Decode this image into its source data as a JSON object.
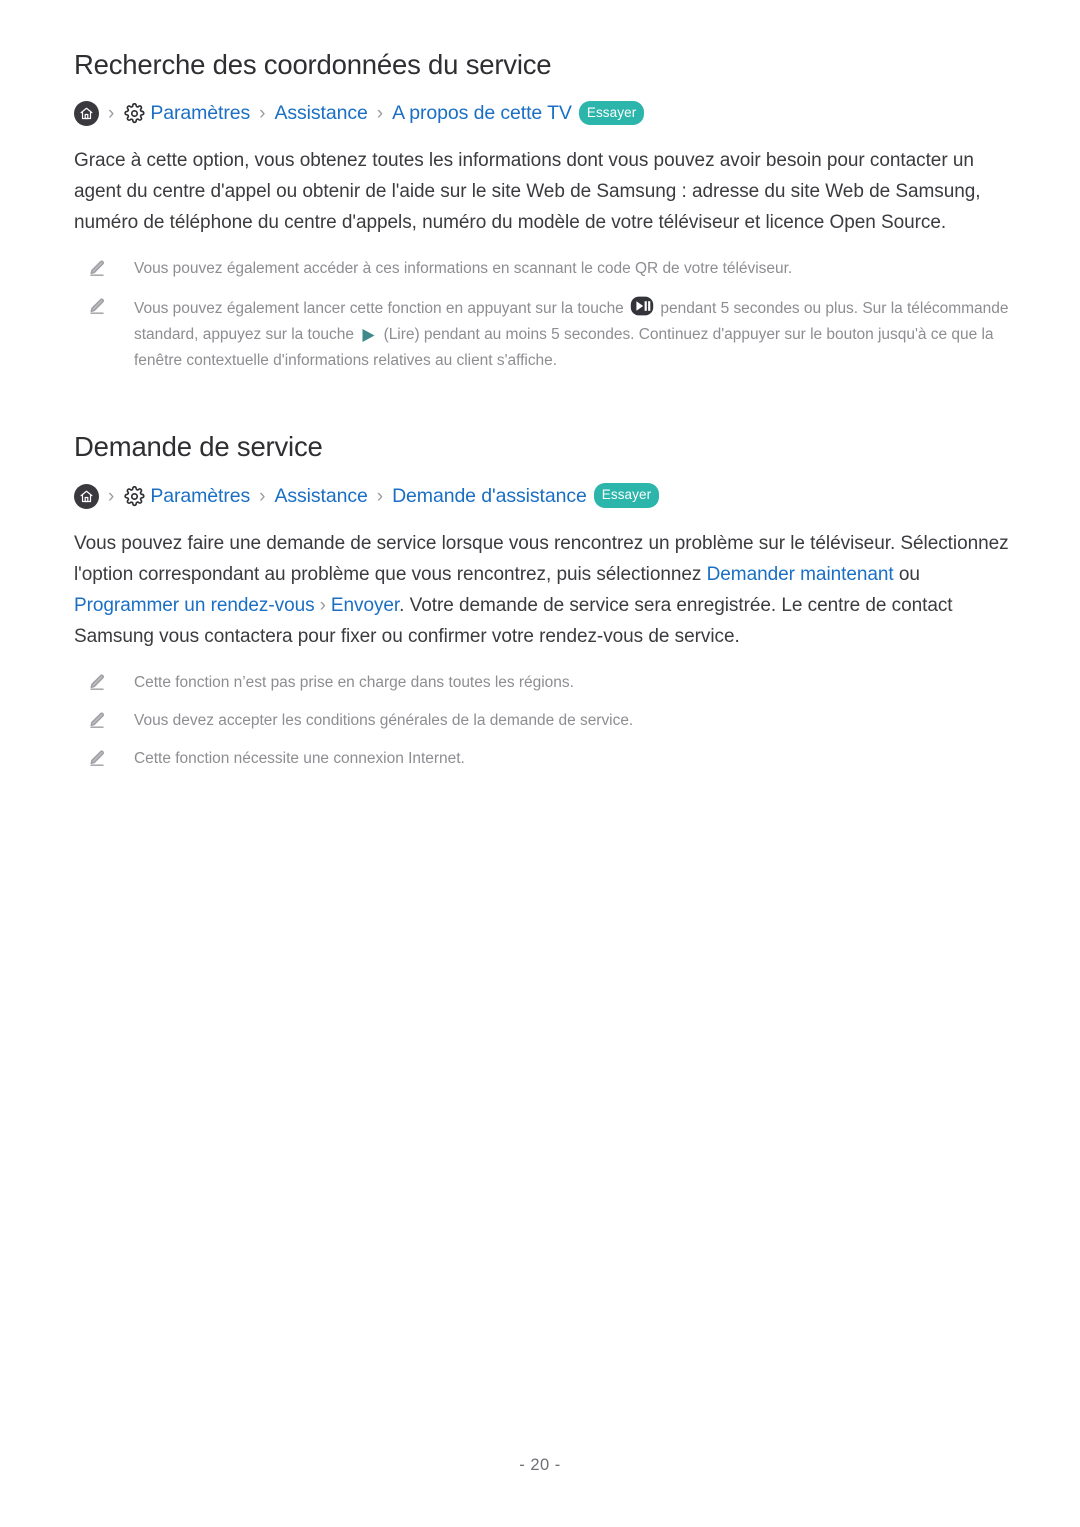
{
  "document": {
    "page_number": "- 20 -"
  },
  "sections": [
    {
      "title": "Recherche des coordonnées du service",
      "breadcrumb": {
        "home_icon": "home-icon",
        "gear_icon": "gear-icon",
        "separator": "›",
        "crumbs": [
          "Paramètres",
          "Assistance",
          "A propos de cette TV"
        ],
        "try_label": "Essayer"
      },
      "paragraph": {
        "text": "Grace à cette option, vous obtenez toutes les informations dont vous pouvez avoir besoin pour contacter un agent du centre d'appel ou obtenir de l'aide sur le site Web de Samsung : adresse du site Web de Samsung, numéro de téléphone du centre d'appels, numéro du modèle de votre téléviseur et licence Open Source."
      },
      "notes": [
        {
          "icon": "pencil-icon",
          "text": "Vous pouvez également accéder à ces informations en scannant le code QR de votre téléviseur."
        },
        {
          "icon": "pencil-icon",
          "part1": "Vous pouvez également lancer cette fonction en appuyant sur la touche",
          "inline_icon_1": "play-pause-button-icon",
          "part2": "pendant 5 secondes ou plus. Sur la télécommande standard, appuyez sur la touche",
          "inline_icon_2": "play-button-icon",
          "part3": "(Lire) pendant au moins 5 secondes. Continuez d'appuyer sur le bouton jusqu'à ce que la fenêtre contextuelle d'informations relatives au client s'affiche."
        }
      ]
    },
    {
      "title": "Demande de service",
      "breadcrumb": {
        "home_icon": "home-icon",
        "gear_icon": "gear-icon",
        "separator": "›",
        "crumbs": [
          "Paramètres",
          "Assistance",
          "Demande d'assistance"
        ],
        "try_label": "Essayer"
      },
      "paragraph": {
        "part1": "Vous pouvez faire une demande de service lorsque vous rencontrez un problème sur le téléviseur. Sélectionnez l'option correspondant au problème que vous rencontrez, puis sélectionnez",
        "link1": "Demander maintenant",
        "connector": "ou",
        "link2": "Programmer un rendez-vous",
        "separator": "›",
        "link3": "Envoyer",
        "part2": ". Votre demande de service sera enregistrée. Le centre de contact Samsung vous contactera pour fixer ou confirmer votre rendez-vous de service."
      },
      "notes": [
        {
          "icon": "pencil-icon",
          "text": "Cette fonction n’est pas prise en charge dans toutes les régions."
        },
        {
          "icon": "pencil-icon",
          "text": "Vous devez accepter les conditions générales de la demande de service."
        },
        {
          "icon": "pencil-icon",
          "text": "Cette fonction nécessite une connexion Internet."
        }
      ]
    }
  ],
  "colors": {
    "link_blue": "#1a6fc4",
    "badge_teal": "#2cb5ab",
    "heading": "#2f2f33",
    "body": "#3b3b3f",
    "note": "#8d8d92",
    "separator": "#9b9ba0",
    "play_icon_teal": "#3f8a8a",
    "home_icon_bg": "#3a3a3e"
  }
}
